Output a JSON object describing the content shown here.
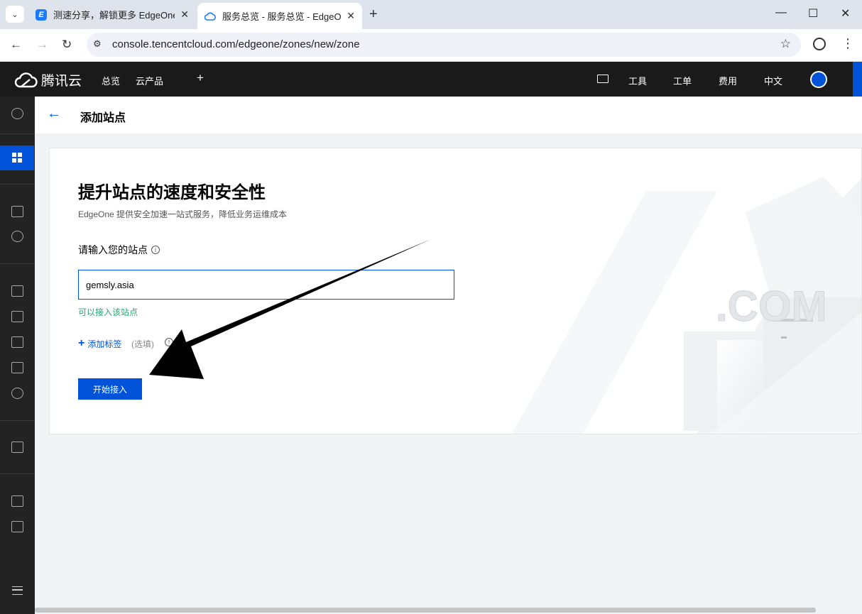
{
  "browser": {
    "tabs": [
      {
        "title": "测速分享，解锁更多 EdgeOne",
        "favicon": "edgeone-icon",
        "active": false
      },
      {
        "title": "服务总览 - 服务总览 - EdgeOne",
        "favicon": "cloud-icon",
        "active": true
      }
    ],
    "url": "console.tencentcloud.com/edgeone/zones/new/zone"
  },
  "header": {
    "brand": "腾讯云",
    "nav_left": [
      "总览",
      "云产品"
    ],
    "nav_right": [
      "工具",
      "工单",
      "费用",
      "中文"
    ]
  },
  "page": {
    "title": "添加站点"
  },
  "form": {
    "hero_title": "提升站点的速度和安全性",
    "hero_subtitle": "EdgeOne 提供安全加速一站式服务，降低业务运维成本",
    "site_label": "请输入您的站点",
    "site_value": "gemsly.asia",
    "valid_message": "可以接入该站点",
    "add_tag_label": "添加标签",
    "optional_label": "(选填)",
    "submit_label": "开始接入",
    "deco_text": ".COM"
  },
  "colors": {
    "brand_blue": "#0052d9",
    "success_green": "#2ba471",
    "header_bg": "#1a1a1a",
    "sidebar_bg": "#232323"
  }
}
